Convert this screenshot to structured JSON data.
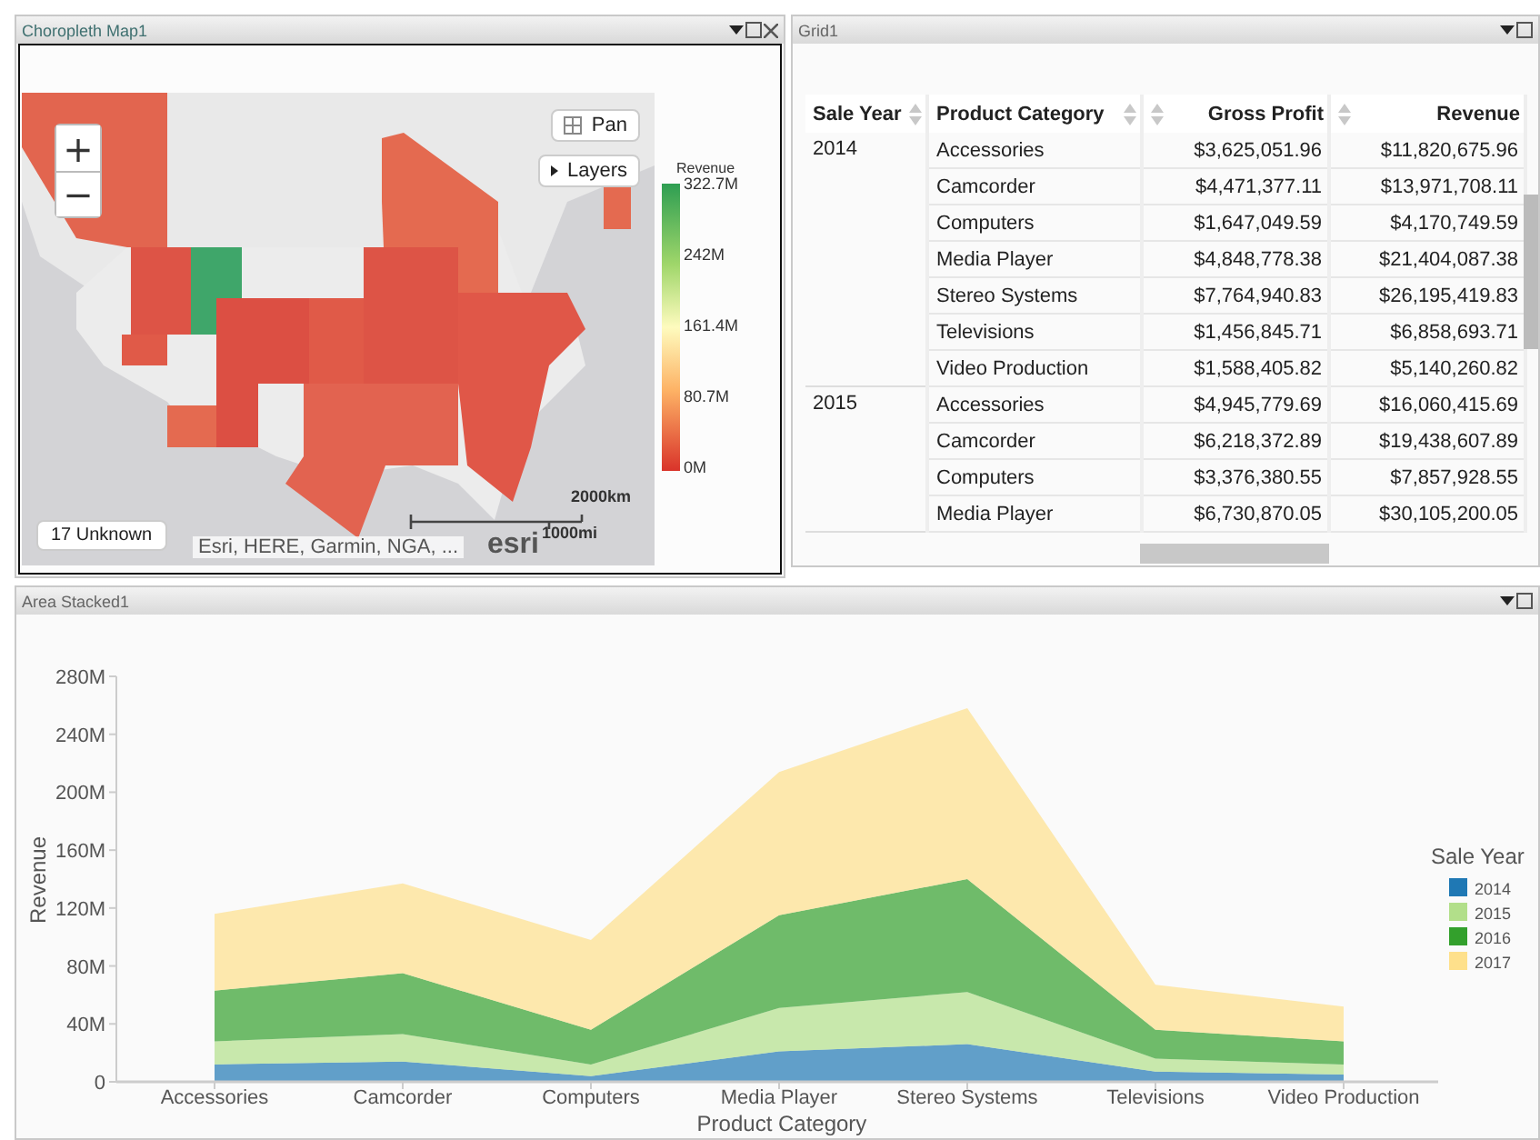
{
  "map_panel": {
    "title": "Choropleth Map1",
    "zoom_in": "+",
    "zoom_out": "−",
    "pan": "Pan",
    "layers": "Layers",
    "legend": {
      "title": "Revenue",
      "labels": [
        "322.7M",
        "242M",
        "161.4M",
        "80.7M",
        "0M"
      ]
    },
    "unknown": "17 Unknown",
    "attribution": "Esri, HERE, Garmin, NGA, ...",
    "logo": "esri",
    "scale": {
      "km": "2000km",
      "mi": "1000mi"
    }
  },
  "grid_panel": {
    "title": "Grid1",
    "columns": [
      "Sale Year",
      "Product Category",
      "Gross Profit",
      "Revenue"
    ],
    "groups": [
      {
        "year": "2014",
        "rows": [
          {
            "category": "Accessories",
            "gross_profit": "$3,625,051.96",
            "revenue": "$11,820,675.96"
          },
          {
            "category": "Camcorder",
            "gross_profit": "$4,471,377.11",
            "revenue": "$13,971,708.11"
          },
          {
            "category": "Computers",
            "gross_profit": "$1,647,049.59",
            "revenue": "$4,170,749.59"
          },
          {
            "category": "Media Player",
            "gross_profit": "$4,848,778.38",
            "revenue": "$21,404,087.38"
          },
          {
            "category": "Stereo Systems",
            "gross_profit": "$7,764,940.83",
            "revenue": "$26,195,419.83"
          },
          {
            "category": "Televisions",
            "gross_profit": "$1,456,845.71",
            "revenue": "$6,858,693.71"
          },
          {
            "category": "Video Production",
            "gross_profit": "$1,588,405.82",
            "revenue": "$5,140,260.82"
          }
        ]
      },
      {
        "year": "2015",
        "rows": [
          {
            "category": "Accessories",
            "gross_profit": "$4,945,779.69",
            "revenue": "$16,060,415.69"
          },
          {
            "category": "Camcorder",
            "gross_profit": "$6,218,372.89",
            "revenue": "$19,438,607.89"
          },
          {
            "category": "Computers",
            "gross_profit": "$3,376,380.55",
            "revenue": "$7,857,928.55"
          },
          {
            "category": "Media Player",
            "gross_profit": "$6,730,870.05",
            "revenue": "$30,105,200.05"
          }
        ]
      }
    ]
  },
  "chart_panel": {
    "title": "Area Stacked1",
    "chart_data": {
      "type": "area",
      "stacked": true,
      "xlabel": "Product Category",
      "ylabel": "Revenue",
      "categories": [
        "Accessories",
        "Camcorder",
        "Computers",
        "Media Player",
        "Stereo Systems",
        "Televisions",
        "Video Production"
      ],
      "series": [
        {
          "name": "2014",
          "color": "#1f78b4",
          "values": [
            12,
            14,
            4,
            21,
            26,
            7,
            5
          ]
        },
        {
          "name": "2015",
          "color": "#b2df8a",
          "values": [
            16,
            19,
            8,
            30,
            36,
            9,
            7
          ]
        },
        {
          "name": "2016",
          "color": "#33a02c",
          "values": [
            35,
            42,
            24,
            64,
            78,
            20,
            16
          ]
        },
        {
          "name": "2017",
          "color": "#fee08b",
          "values": [
            53,
            62,
            62,
            99,
            118,
            31,
            24
          ]
        }
      ],
      "ylim": [
        0,
        280
      ],
      "yticks": [
        {
          "value": 0,
          "label": "0"
        },
        {
          "value": 40,
          "label": "40M"
        },
        {
          "value": 80,
          "label": "80M"
        },
        {
          "value": 120,
          "label": "120M"
        },
        {
          "value": 160,
          "label": "160M"
        },
        {
          "value": 200,
          "label": "200M"
        },
        {
          "value": 240,
          "label": "240M"
        },
        {
          "value": 280,
          "label": "280M"
        }
      ],
      "legend": {
        "title": "Sale Year"
      }
    }
  }
}
